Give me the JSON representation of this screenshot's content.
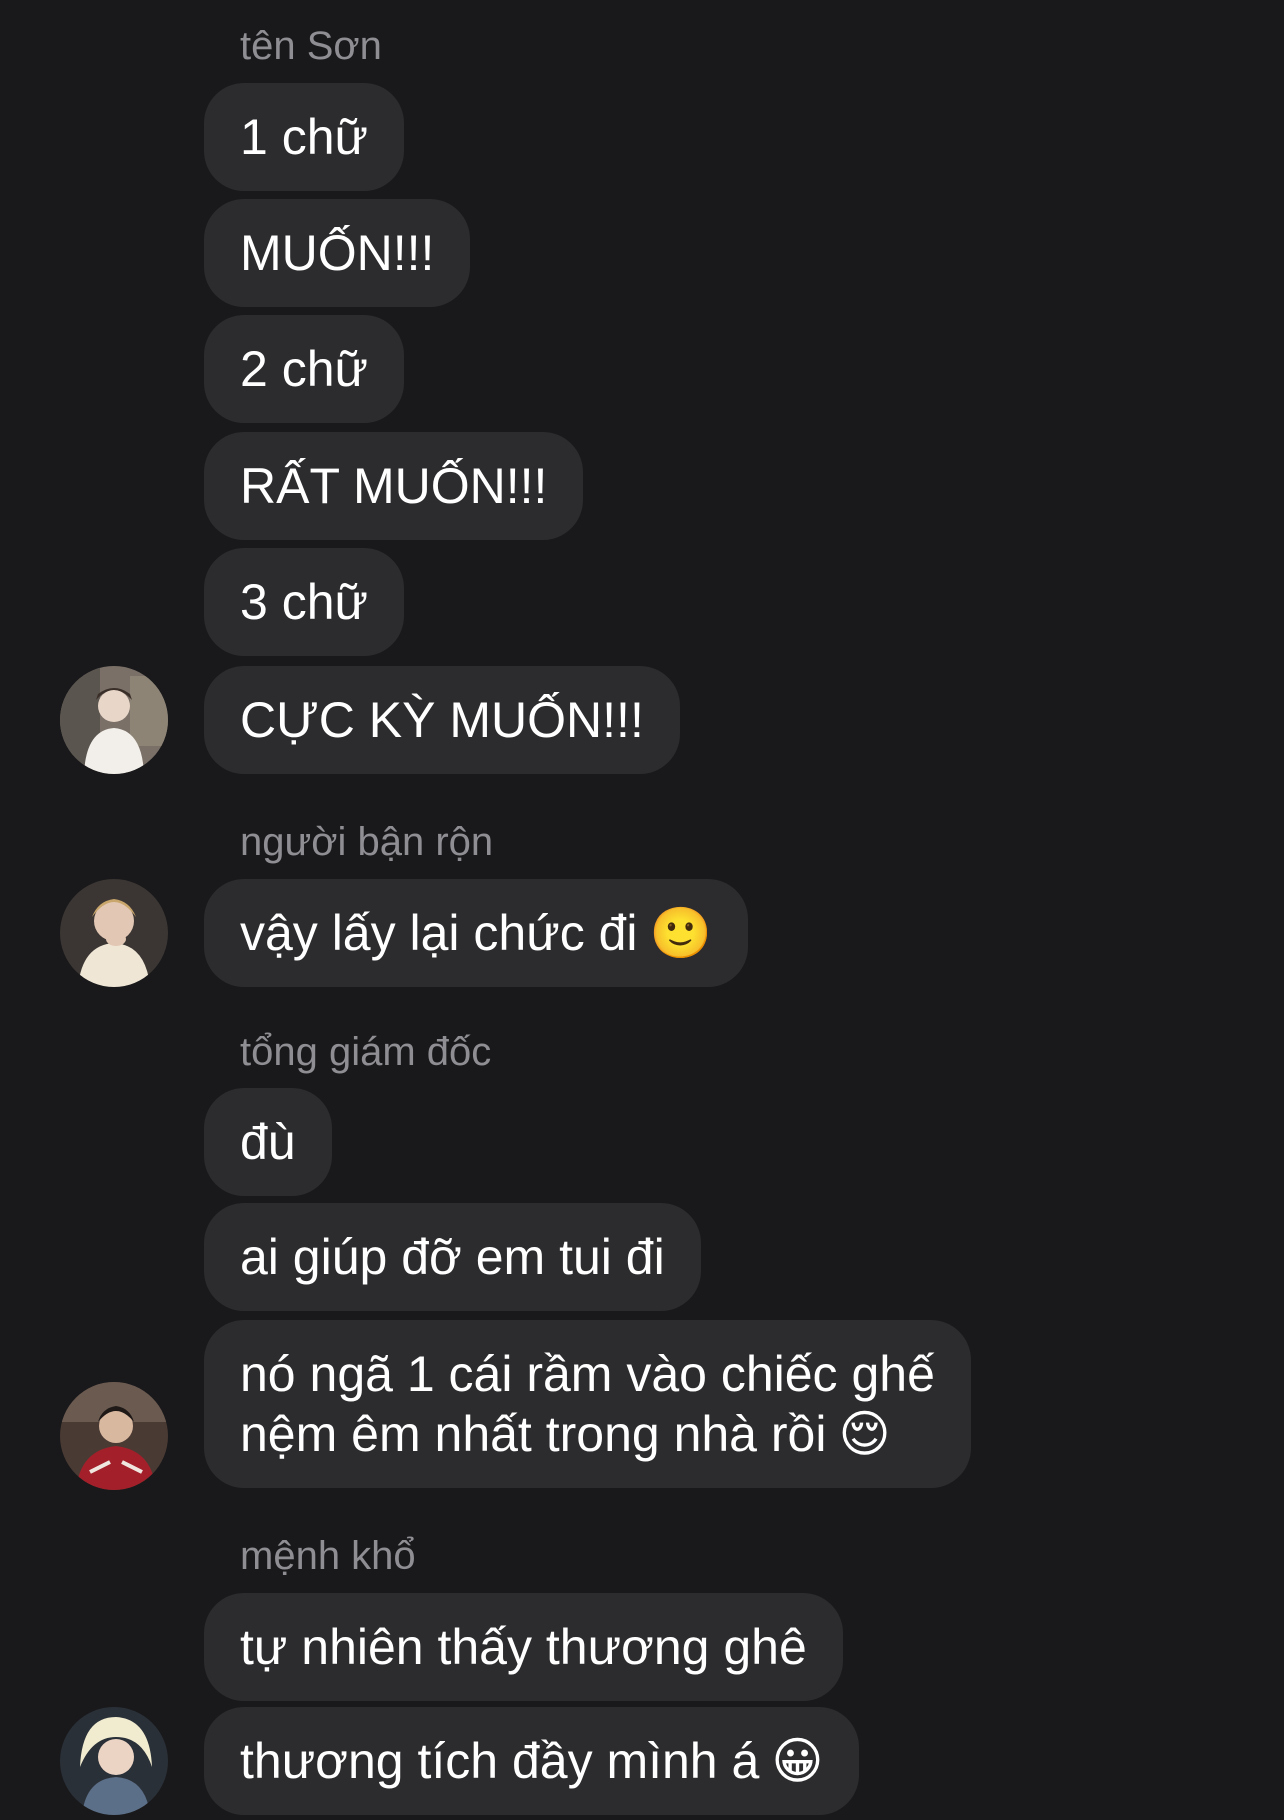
{
  "groups": [
    {
      "sender": "tên Sơn",
      "messages": [
        "1 chữ",
        "MUỐN!!!",
        "2 chữ",
        "RẤT MUỐN!!!",
        "3 chữ",
        "CỰC KỲ MUỐN!!!"
      ]
    },
    {
      "sender": "người bận rộn",
      "messages": [
        "vậy lấy lại chức đi",
        "🙂"
      ]
    },
    {
      "sender": "tổng giám đốc",
      "messages": [
        "đù",
        "ai giúp đỡ em tui đi",
        "nó ngã 1 cái rầm vào chiếc ghế",
        "nệm êm nhất trong nhà rồi",
        "😌"
      ]
    },
    {
      "sender": "mệnh khổ",
      "messages": [
        "tự nhiên thấy thương ghê",
        "thương tích đầy mình á",
        "😀"
      ]
    }
  ],
  "colors": {
    "background": "#19191b",
    "bubble": "#2c2c2e",
    "sender_label": "#8e8e93",
    "message_text": "#ffffff"
  },
  "avatars": [
    "avatar-photo-1",
    "avatar-photo-2",
    "avatar-photo-3",
    "avatar-photo-4"
  ]
}
